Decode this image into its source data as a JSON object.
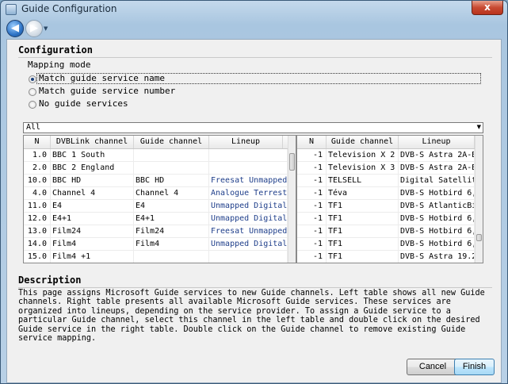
{
  "window": {
    "title": "Guide Configuration",
    "close_label": "x"
  },
  "nav": {
    "back_glyph": "◀",
    "forward_glyph": "▶",
    "dropdown_glyph": "▼"
  },
  "configuration": {
    "heading": "Configuration",
    "mapping_mode": {
      "label": "Mapping mode",
      "options": [
        {
          "label": "Match guide service name",
          "selected": true
        },
        {
          "label": "Match guide service number",
          "selected": false
        },
        {
          "label": "No guide services",
          "selected": false
        }
      ]
    }
  },
  "filter": {
    "value": "All",
    "arrow": "▼"
  },
  "left_table": {
    "columns": [
      "N",
      "DVBLink channel",
      "Guide channel",
      "Lineup"
    ],
    "rows": [
      [
        "1.0",
        "BBC 1 South",
        "",
        ""
      ],
      [
        "2.0",
        "BBC 2 England",
        "",
        ""
      ],
      [
        "10.0",
        "BBC HD",
        "BBC HD",
        "Freesat Unmapped"
      ],
      [
        "4.0",
        "Channel 4",
        "Channel 4",
        "Analogue Terrest"
      ],
      [
        "11.0",
        "E4",
        "E4",
        "Unmapped Digital"
      ],
      [
        "12.0",
        "E4+1",
        "E4+1",
        "Unmapped Digital"
      ],
      [
        "13.0",
        "Film24",
        "Film24",
        "Freesat Unmapped"
      ],
      [
        "14.0",
        "Film4",
        "Film4",
        "Unmapped Digital"
      ],
      [
        "15.0",
        "Film4 +1",
        "",
        ""
      ]
    ]
  },
  "right_table": {
    "columns": [
      "N",
      "Guide channel",
      "Lineup"
    ],
    "rows": [
      [
        "-1",
        "Television X 2",
        "DVB-S Astra 2A-B"
      ],
      [
        "-1",
        "Television X 3",
        "DVB-S Astra 2A-B"
      ],
      [
        "-1",
        "TELSELL",
        "Digital Satellit"
      ],
      [
        "-1",
        "Téva",
        "DVB-S Hotbird 6,"
      ],
      [
        "-1",
        "TF1",
        "DVB-S AtlanticBi"
      ],
      [
        "-1",
        "TF1",
        "DVB-S Hotbird 6,"
      ],
      [
        "-1",
        "TF1",
        "DVB-S Hotbird 6,"
      ],
      [
        "-1",
        "TF1",
        "DVB-S Hotbird 6,"
      ],
      [
        "-1",
        "TF1",
        "DVB-S Astra 19.2"
      ]
    ]
  },
  "description": {
    "heading": "Description",
    "text": "This page assigns Microsoft Guide services to new Guide channels. Left table shows all new Guide channels. Right table presents all available Microsoft Guide services. These services are organized into lineups, depending on the service provider. To assign a Guide service to a particular Guide channel, select this channel in the left table and double click on the desired Guide service in the right table. Double click on the Guide channel to remove existing Guide service mapping."
  },
  "buttons": {
    "cancel": "Cancel",
    "finish": "Finish"
  }
}
